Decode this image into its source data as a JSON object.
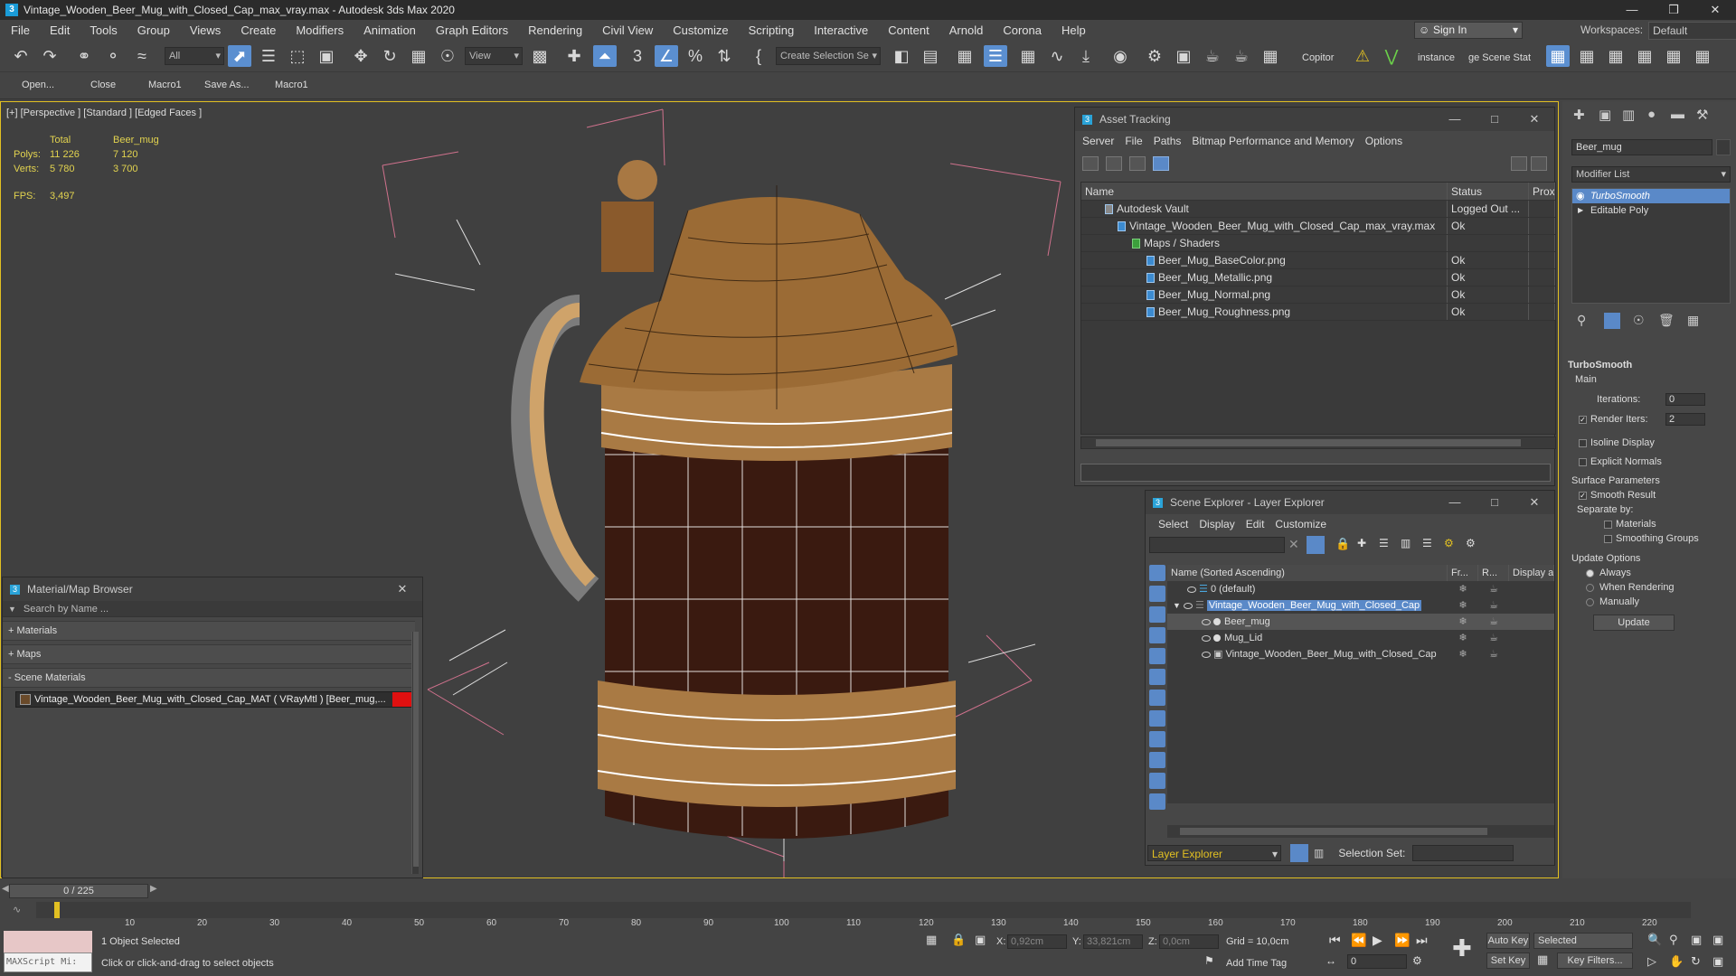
{
  "window": {
    "title": "Vintage_Wooden_Beer_Mug_with_Closed_Cap_max_vray.max - Autodesk 3ds Max 2020",
    "min": "—",
    "max": "❒",
    "close": "✕"
  },
  "menu": [
    "File",
    "Edit",
    "Tools",
    "Group",
    "Views",
    "Create",
    "Modifiers",
    "Animation",
    "Graph Editors",
    "Rendering",
    "Civil View",
    "Customize",
    "Scripting",
    "Interactive",
    "Content",
    "Arnold",
    "Corona",
    "Help"
  ],
  "signin": "Sign In",
  "workspaces": {
    "label": "Workspaces:",
    "value": "Default"
  },
  "toolbar": {
    "filter": "All",
    "refcoord": "View",
    "selection_set": "Create Selection Se",
    "copitor": "Copitor",
    "instance": "instance",
    "scene_stat": "ge Scene Stat"
  },
  "macros": [
    "Open...",
    "Close",
    "Macro1",
    "Save As...",
    "Macro1"
  ],
  "viewport": {
    "label": "[+] [Perspective ] [Standard ] [Edged Faces ]",
    "stats": {
      "total_label": "Total",
      "obj_label": "Beer_mug",
      "polys_label": "Polys:",
      "polys_total": "11 226",
      "polys_obj": "7 120",
      "verts_label": "Verts:",
      "verts_total": "5 780",
      "verts_obj": "3 700",
      "fps_label": "FPS:",
      "fps": "3,497"
    }
  },
  "asset_tracking": {
    "title": "Asset Tracking",
    "menu": [
      "Server",
      "File",
      "Paths",
      "Bitmap Performance and Memory",
      "Options"
    ],
    "columns": [
      "Name",
      "Status",
      "Prox"
    ],
    "rows": [
      {
        "name": "Autodesk Vault",
        "status": "Logged Out ..."
      },
      {
        "name": "Vintage_Wooden_Beer_Mug_with_Closed_Cap_max_vray.max",
        "status": "Ok"
      },
      {
        "name": "Maps / Shaders",
        "status": ""
      },
      {
        "name": "Beer_Mug_BaseColor.png",
        "status": "Ok"
      },
      {
        "name": "Beer_Mug_Metallic.png",
        "status": "Ok"
      },
      {
        "name": "Beer_Mug_Normal.png",
        "status": "Ok"
      },
      {
        "name": "Beer_Mug_Roughness.png",
        "status": "Ok"
      }
    ]
  },
  "material_browser": {
    "title": "Material/Map Browser",
    "search_placeholder": "Search by Name ...",
    "sections": [
      "+ Materials",
      "+ Maps",
      "- Scene Materials"
    ],
    "material": "Vintage_Wooden_Beer_Mug_with_Closed_Cap_MAT ( VRayMtl ) [Beer_mug,..."
  },
  "scene_explorer": {
    "title": "Scene Explorer - Layer Explorer",
    "menu": [
      "Select",
      "Display",
      "Edit",
      "Customize"
    ],
    "columns": [
      "Name (Sorted Ascending)",
      "Fr...",
      "R...",
      "Display as"
    ],
    "rows": [
      {
        "name": "0 (default)"
      },
      {
        "name": "Vintage_Wooden_Beer_Mug_with_Closed_Cap"
      },
      {
        "name": "Beer_mug"
      },
      {
        "name": "Mug_Lid"
      },
      {
        "name": "Vintage_Wooden_Beer_Mug_with_Closed_Cap"
      }
    ],
    "layer_explorer": "Layer Explorer",
    "selection_set": "Selection Set:"
  },
  "command_panel": {
    "object_name": "Beer_mug",
    "modifier_list": "Modifier List",
    "stack": [
      "TurboSmooth",
      "Editable Poly"
    ],
    "turbosmooth": {
      "title": "TurboSmooth",
      "main": "Main",
      "iterations_label": "Iterations:",
      "iterations": "0",
      "render_iters_label": "Render Iters:",
      "render_iters": "2",
      "isoline": "Isoline Display",
      "explicit": "Explicit Normals",
      "surface": "Surface Parameters",
      "smooth_result": "Smooth Result",
      "separate_by": "Separate by:",
      "materials": "Materials",
      "smoothing_groups": "Smoothing Groups",
      "update_options": "Update Options",
      "always": "Always",
      "when_rendering": "When Rendering",
      "manually": "Manually",
      "update": "Update"
    }
  },
  "timeline": {
    "frame": "0 / 225",
    "ticks": [
      "10",
      "20",
      "30",
      "40",
      "50",
      "60",
      "70",
      "80",
      "90",
      "100",
      "110",
      "120",
      "130",
      "140",
      "150",
      "160",
      "170",
      "180",
      "190",
      "200",
      "210",
      "220"
    ]
  },
  "status": {
    "maxscript": "MAXScript Mi:",
    "selected": "1 Object Selected",
    "prompt": "Click or click-and-drag to select objects",
    "x_label": "X:",
    "x": "0,92cm",
    "y_label": "Y:",
    "y": "33,821cm",
    "z_label": "Z:",
    "z": "0,0cm",
    "grid": "Grid = 10,0cm",
    "add_time_tag": "Add Time Tag",
    "auto_key": "Auto Key",
    "set_key": "Set Key",
    "selected_dd": "Selected",
    "key_filters": "Key Filters...",
    "frame_field": "0"
  }
}
